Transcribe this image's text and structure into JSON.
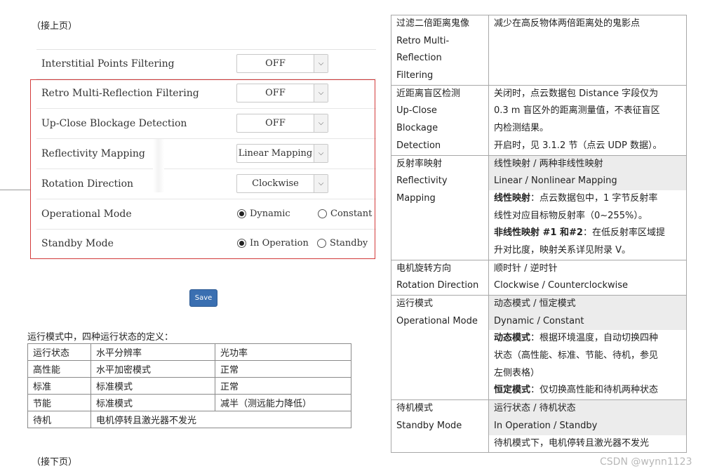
{
  "page": {
    "continued_from": "（接上页）",
    "continued_next": "（接下页）",
    "watermark": "CSDN @wynn1123"
  },
  "settings": {
    "rows": [
      {
        "label": "Interstitial Points Filtering",
        "value": "OFF"
      },
      {
        "label": "Retro Multi-Reflection Filtering",
        "value": "OFF"
      },
      {
        "label": "Up-Close Blockage Detection",
        "value": "OFF"
      },
      {
        "label": "Reflectivity Mapping",
        "value": "Linear Mapping"
      },
      {
        "label": "Rotation Direction",
        "value": "Clockwise"
      }
    ],
    "operational_mode": {
      "label": "Operational Mode",
      "options": [
        "Dynamic",
        "Constant"
      ],
      "selected": "Dynamic"
    },
    "standby_mode": {
      "label": "Standby Mode",
      "options": [
        "In Operation",
        "Standby"
      ],
      "selected": "In Operation"
    },
    "save_label": "Save"
  },
  "state_table": {
    "caption": "运行模式中，四种运行状态的定义：",
    "headers": [
      "运行状态",
      "水平分辨率",
      "光功率"
    ],
    "rows": [
      [
        "高性能",
        "水平加密模式",
        "正常"
      ],
      [
        "标准",
        "标准模式",
        "正常"
      ],
      [
        "节能",
        "标准模式",
        "减半（测远能力降低）"
      ],
      [
        "待机",
        "电机停转且激光器不发光"
      ]
    ]
  },
  "desc_table": {
    "retro": {
      "name": [
        "过滤二倍距离鬼像",
        "Retro Multi-",
        "Reflection",
        "Filtering"
      ],
      "desc": [
        "减少在高反物体两倍距离处的鬼影点"
      ]
    },
    "upclose": {
      "name": [
        "近距离盲区检测",
        "Up-Close",
        "Blockage",
        "Detection"
      ],
      "desc": [
        "关闭时，点云数据包 Distance 字段仅为",
        "0.3 m 盲区外的距离测量值，不表征盲区",
        "内检测结果。",
        "开启时，见 3.1.2 节（点云 UDP 数据）。"
      ]
    },
    "reflectivity": {
      "name": [
        "反射率映射",
        "Reflectivity",
        "Mapping"
      ],
      "options_cn": "线性映射  /  两种非线性映射",
      "options_en": "Linear / Nonlinear Mapping",
      "linear_term": "线性映射",
      "linear_desc": "：点云数据包中，1 字节反射率",
      "linear_desc2": "线性对应目标物反射率（0~255%）。",
      "nonlinear_term": "非线性映射 #1 和#2",
      "nonlinear_desc": "：在低反射率区域提",
      "nonlinear_desc2": "升对比度，映射关系详见附录 V。"
    },
    "rotation": {
      "name": [
        "电机旋转方向",
        "Rotation Direction"
      ],
      "desc": [
        "顺时针  /  逆时针",
        "Clockwise / Counterclockwise"
      ]
    },
    "operational": {
      "name": [
        "运行模式",
        "Operational Mode"
      ],
      "options_cn": "动态模式  /  恒定模式",
      "options_en": "Dynamic / Constant",
      "dynamic_term": "动态模式",
      "dynamic_desc": "：根据环境温度，自动切换四种",
      "dynamic_desc2": "状态（高性能、标准、节能、待机，参见",
      "dynamic_desc3": "左侧表格）",
      "constant_term": "恒定模式",
      "constant_desc": "：仅切换高性能和待机两种状态"
    },
    "standby": {
      "name": [
        "待机模式",
        "Standby Mode"
      ],
      "options_cn": "运行状态  /  待机状态",
      "options_en": "In Operation / Standby",
      "desc": "待机模式下，电机停转且激光器不发光"
    }
  }
}
